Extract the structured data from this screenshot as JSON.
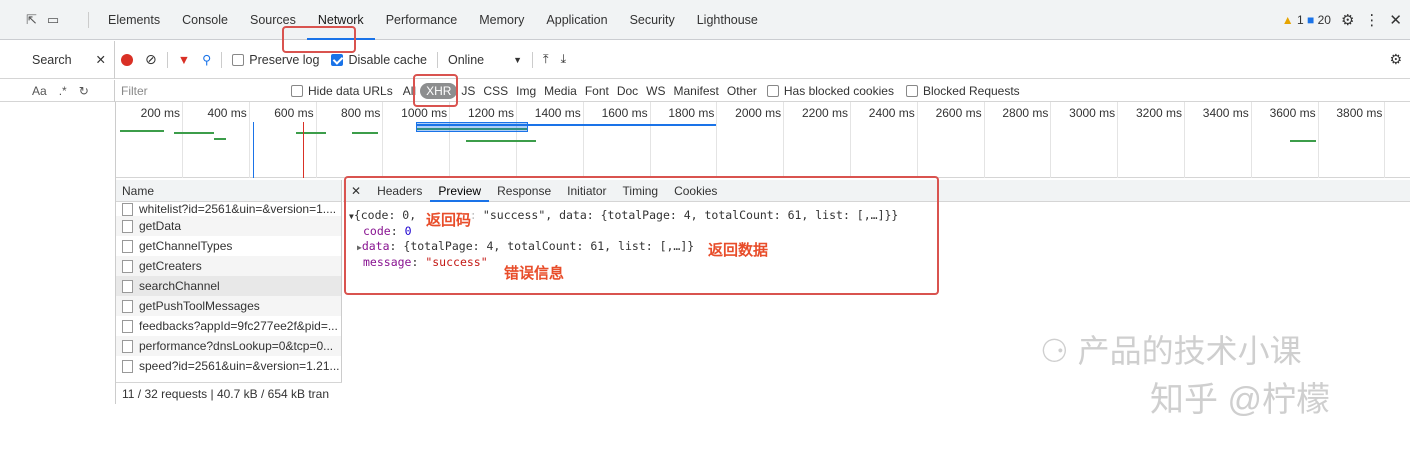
{
  "devtools": {
    "tabs": [
      "Elements",
      "Console",
      "Sources",
      "Network",
      "Performance",
      "Memory",
      "Application",
      "Security",
      "Lighthouse"
    ],
    "active_tab": "Network",
    "warnings": "1",
    "messages": "20"
  },
  "toolbar": {
    "search_label": "Search",
    "preserve_log": "Preserve log",
    "disable_cache": "Disable cache",
    "throttle": "Online"
  },
  "filter": {
    "placeholder": "Filter",
    "hide_data_urls": "Hide data URLs",
    "types": [
      "All",
      "XHR",
      "JS",
      "CSS",
      "Img",
      "Media",
      "Font",
      "Doc",
      "WS",
      "Manifest",
      "Other"
    ],
    "has_blocked_cookies": "Has blocked cookies",
    "blocked_requests": "Blocked Requests"
  },
  "timeline": {
    "ticks": [
      "200 ms",
      "400 ms",
      "600 ms",
      "800 ms",
      "1000 ms",
      "1200 ms",
      "1400 ms",
      "1600 ms",
      "1800 ms",
      "2000 ms",
      "2200 ms",
      "2400 ms",
      "2600 ms",
      "2800 ms",
      "3000 ms",
      "3200 ms",
      "3400 ms",
      "3600 ms",
      "3800 ms"
    ]
  },
  "requests": {
    "header": "Name",
    "items": [
      "whitelist?id=2561&uin=&version=1....",
      "getData",
      "getChannelTypes",
      "getCreaters",
      "searchChannel",
      "getPushToolMessages",
      "feedbacks?appId=9fc277ee2f&pid=...",
      "performance?dnsLookup=0&tcp=0...",
      "speed?id=2561&uin=&version=1.21..."
    ],
    "status": "11 / 32 requests  |  40.7 kB / 654 kB tran"
  },
  "detail": {
    "tabs": [
      "Headers",
      "Preview",
      "Response",
      "Initiator",
      "Timing",
      "Cookies"
    ],
    "active_tab": "Preview",
    "line1_a": "{code: 0, ",
    "line1_b": ": \"success\", data: {totalPage: 4, totalCount: 61, list: [,…]}}",
    "code_key": "code",
    "code_val": "0",
    "data_key": "data",
    "data_val": "{totalPage: 4, totalCount: 61, list: [,…]}",
    "message_key": "message",
    "message_val": "\"success\""
  },
  "annotations": {
    "return_code": "返回码",
    "return_data": "返回数据",
    "error_info": "错误信息"
  },
  "watermark": {
    "line1": "产品的技术小课",
    "line2": "知乎 @柠檬"
  }
}
